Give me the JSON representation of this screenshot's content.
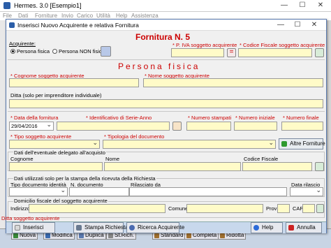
{
  "main": {
    "title": "Hermes. 3.0 [Esempio1]",
    "menu": [
      "File",
      "Dati",
      "Forniture",
      "Invio",
      "Carico",
      "Utilità",
      "Help",
      "Assistenza"
    ],
    "bottom_buttons": [
      "Nuova",
      "Modifica",
      "Duplica",
      "St.Rich.",
      "Standard",
      "Completa",
      "Ridotta"
    ]
  },
  "dialog": {
    "title": "Inserisci Nuovo Acquirente e relativa Fornitura",
    "heading": "Fornitura N. 5",
    "acquirente_label": "Acquirente:",
    "radio_persona_fisica": "Persona fisica",
    "radio_persona_non_fisica": "Persona NON fisica",
    "piva_label": "* P. IVA soggetto acquirente",
    "cf_label": "* Codice Fiscale soggetto acquirente",
    "section_title": "Persona fisica",
    "cognome_label": "* Cognome soggetto acquirente",
    "nome_label": "* Nome soggetto acquirente",
    "ditta_label": "Ditta (solo per imprenditore individuale)",
    "data_fornitura_label": "* Data della fornitura",
    "data_fornitura_value": "29/04/2016",
    "id_serie_label": "* Identificativo di Serie-Anno",
    "num_stampati_label": "* Numero stampati",
    "num_iniziale_label": "* Numero iniziale",
    "num_finale_label": "* Numero finale",
    "tipo_soggetto_label": "* Tipo soggetto acquirente",
    "tipologia_doc_label": "* Tipologia del documento",
    "altre_forniture_label": "Altre Forniture",
    "delegato_label": "Dati dell'eventuale delegato all'acquisto",
    "del_cognome_label": "Cognome",
    "del_nome_label": "Nome",
    "del_cf_label": "Codice Fiscale",
    "stampa_section_label": "Dati utilizzati solo per la stampa della ricevuta della Richiesta",
    "tipo_doc_id_label": "Tipo documento identità",
    "n_doc_label": "N. documento",
    "rilasciato_label": "Rilasciato da",
    "data_rilascio_label": "Data rilascio",
    "domicilio_label": "Domicilio fiscale del soggetto acquirente",
    "indirizzo_label": "Indirizzo",
    "comune_label": "Comune",
    "prov_label": "Prov",
    "cap_label": "CAP",
    "footer_buttons": {
      "inserisci": "Inserisci",
      "stampa": "Stampa Richiesta",
      "ricerca": "Ricerca Acquirente",
      "help": "Help",
      "annulla": "Annulla"
    },
    "behind_text": "Ditta soggetto acquirente"
  },
  "colors": {
    "required": "#cc0000",
    "field_yellow": "#fffbc8",
    "heading": "#cc0000"
  }
}
